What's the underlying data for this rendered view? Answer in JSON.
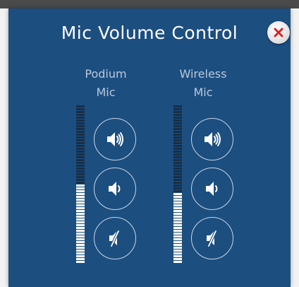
{
  "dialog": {
    "title": "Mic Volume Control",
    "close_icon": "close-x-icon",
    "accent_close": "#e02020",
    "panel_color": "#1c4e80"
  },
  "channels": [
    {
      "id": "podium",
      "label": "Podium\nMic",
      "level": 0.5,
      "buttons": [
        {
          "action": "volume-up",
          "icon": "speaker-loud-icon"
        },
        {
          "action": "volume-down",
          "icon": "speaker-quiet-icon"
        },
        {
          "action": "mute",
          "icon": "speaker-mute-icon"
        }
      ]
    },
    {
      "id": "wireless",
      "label": "Wireless\nMic",
      "level": 0.45,
      "buttons": [
        {
          "action": "volume-up",
          "icon": "speaker-loud-icon"
        },
        {
          "action": "volume-down",
          "icon": "speaker-quiet-icon"
        },
        {
          "action": "mute",
          "icon": "speaker-mute-icon"
        }
      ]
    }
  ]
}
